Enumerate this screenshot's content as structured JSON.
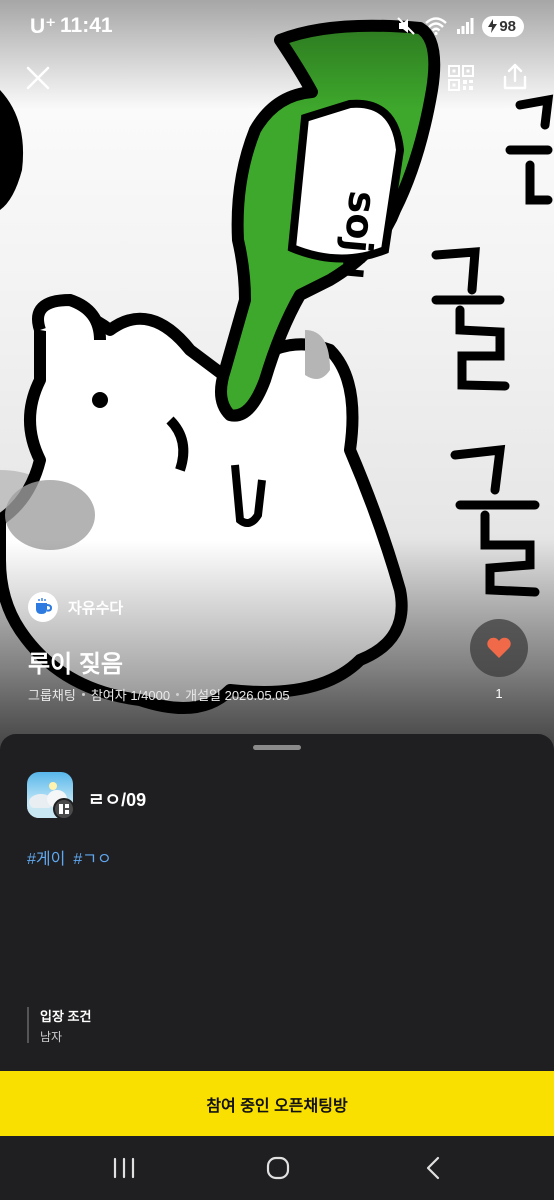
{
  "status_bar": {
    "carrier": "U⁺",
    "time": "11:41",
    "battery": "98",
    "icons": [
      "mute-icon",
      "wifi-icon",
      "signal-icon",
      "charging-icon"
    ]
  },
  "top_actions": {
    "icons": [
      "close-icon",
      "qr-code-icon",
      "share-icon"
    ]
  },
  "room": {
    "category": "자유수다",
    "category_icon": "coffee-cup-icon",
    "title": "루이 짖음",
    "type": "그룹채팅",
    "participants": "참여자 1/4000",
    "created": "개설일 2026.05.05",
    "like_count": "1",
    "like_icon": "heart-icon"
  },
  "sheet": {
    "host_name": "ㄹㅇ/09",
    "tags": [
      "#게이",
      "#ㄱㅇ"
    ],
    "entry_condition": {
      "title": "입장 조건",
      "value": "남자"
    }
  },
  "cta": {
    "label": "참여 중인 오픈채팅방"
  },
  "nav": {
    "icons": [
      "recent-apps-icon",
      "home-icon",
      "back-icon"
    ]
  },
  "colors": {
    "accent_yellow": "#f9e000",
    "sheet_bg": "#1f1f21",
    "tag_blue": "#5fa8f0",
    "heart_red": "#f06a4a",
    "bottle_green": "#3ea82c"
  }
}
